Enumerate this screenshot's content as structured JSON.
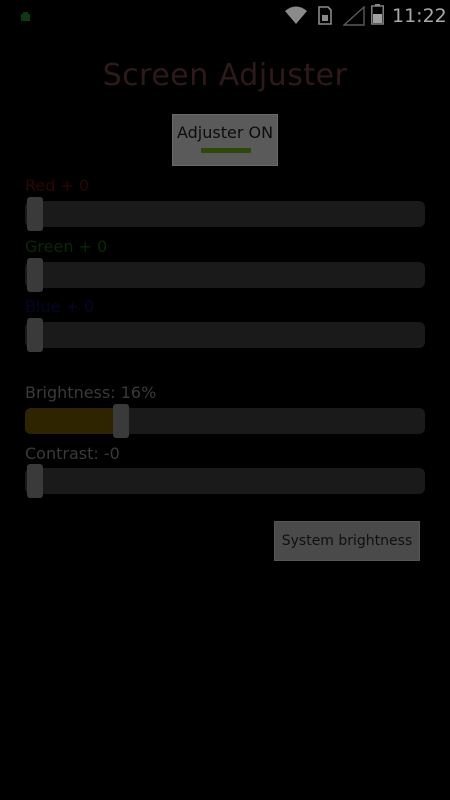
{
  "status_bar": {
    "time": "11:22",
    "icons": [
      "notification-dot-icon",
      "wifi-icon",
      "sim-card-icon",
      "signal-icon",
      "battery-icon"
    ]
  },
  "app": {
    "title": "Screen Adjuster"
  },
  "toggle": {
    "label": "Adjuster ON",
    "state": "on",
    "indicator_color": "#2c4a05"
  },
  "sliders": {
    "red": {
      "label": "Red + 0",
      "value": 0,
      "max": 100
    },
    "green": {
      "label": "Green + 0",
      "value": 0,
      "max": 100
    },
    "blue": {
      "label": "Blue + 0",
      "value": 0,
      "max": 100
    },
    "brightness": {
      "label": "Brightness: 16%",
      "value": 16,
      "max": 100
    },
    "contrast": {
      "label": "Contrast: -0",
      "value": 0,
      "max": 100
    }
  },
  "buttons": {
    "system_brightness": "System brightness"
  },
  "colors": {
    "red_label": "#2a0606",
    "green_label": "#082808",
    "blue_label": "#05052a",
    "brightness_fill": "#2e2500"
  }
}
